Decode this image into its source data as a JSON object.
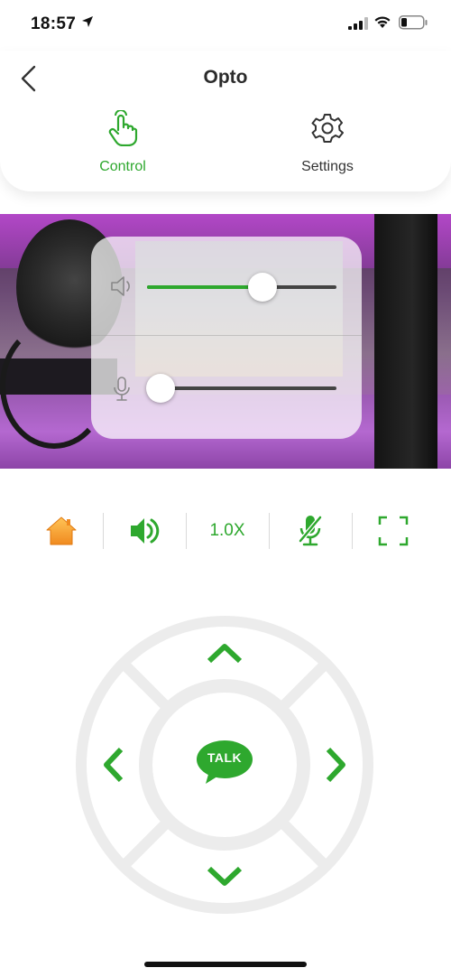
{
  "status_bar": {
    "time": "18:57"
  },
  "header": {
    "title": "Opto"
  },
  "tabs": [
    {
      "label": "Control",
      "active": true,
      "icon": "touch-hand-icon"
    },
    {
      "label": "Settings",
      "active": false,
      "icon": "gear-icon"
    }
  ],
  "audio_panel": {
    "speaker_volume": 0.61,
    "mic_volume": 0.07
  },
  "toolbar": {
    "zoom_label": "1.0X",
    "items": [
      "home-icon",
      "speaker-icon",
      "zoom-label",
      "mic-muted-icon",
      "fullscreen-icon"
    ]
  },
  "dpad": {
    "talk_label": "TALK"
  },
  "colors": {
    "accent": "#2ea82e",
    "home_orange": "#f4a23a",
    "dpad_ring": "#ececec"
  }
}
